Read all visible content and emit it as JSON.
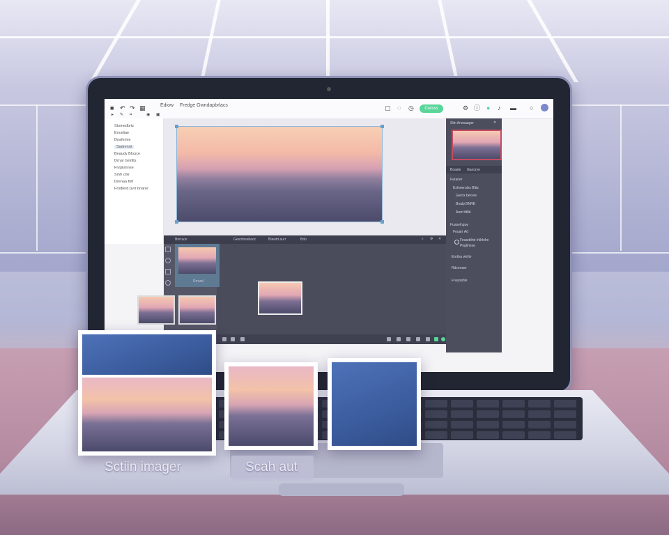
{
  "app": {
    "toolbar": {
      "breadcrumb": "Ediow",
      "title": "Fredge Gwndapbrlacs",
      "status_pill": "Cwtsss"
    },
    "left_panel": {
      "layers": [
        "Stomedbrtz",
        "Enceliae",
        "Dnafemie",
        "Sadrennt",
        "Beaudy Blouce",
        "Drnar Gnrltts",
        "Fnrpkmnee",
        "Sinfr crkr",
        "Drenaa fnfr",
        "Frodlerd pvrr bnarer"
      ]
    },
    "dark_panel": {
      "left_tab": "Bnrrace",
      "tabs": [
        "Gesmbsebaoc",
        "Blawtd aurr",
        "Brlo"
      ],
      "selected_thumb_label": "Rrrarsl"
    },
    "right_panel": {
      "header": "Sltn Anosaager",
      "tabs": [
        "Boasle",
        "Gancrye"
      ],
      "sections": [
        {
          "label": "Faraner"
        },
        {
          "label": "Ezlnnerulss Blttz"
        },
        {
          "label": "Garnx bersve"
        },
        {
          "label": "Bnalp BNRE"
        },
        {
          "label": "Anrrt fdlld"
        },
        {
          "label": "Fuaselngue"
        },
        {
          "label": "Fouarr Ad"
        },
        {
          "label": "Fnasddrte Inllrlelre"
        },
        {
          "label": "Pnglinese"
        },
        {
          "label": "Enrtlss wlrfirr"
        },
        {
          "label": "Rdcenaer"
        },
        {
          "label": "Fnasssfiie"
        }
      ]
    }
  },
  "captions": {
    "left": "Sctiin imager",
    "center": "Scah aut"
  },
  "colors": {
    "accent": "#5ad59a",
    "selection": "#6aa0c9",
    "panel_dark": "#4a4c5c",
    "blue_card": "#3b5c9e"
  }
}
